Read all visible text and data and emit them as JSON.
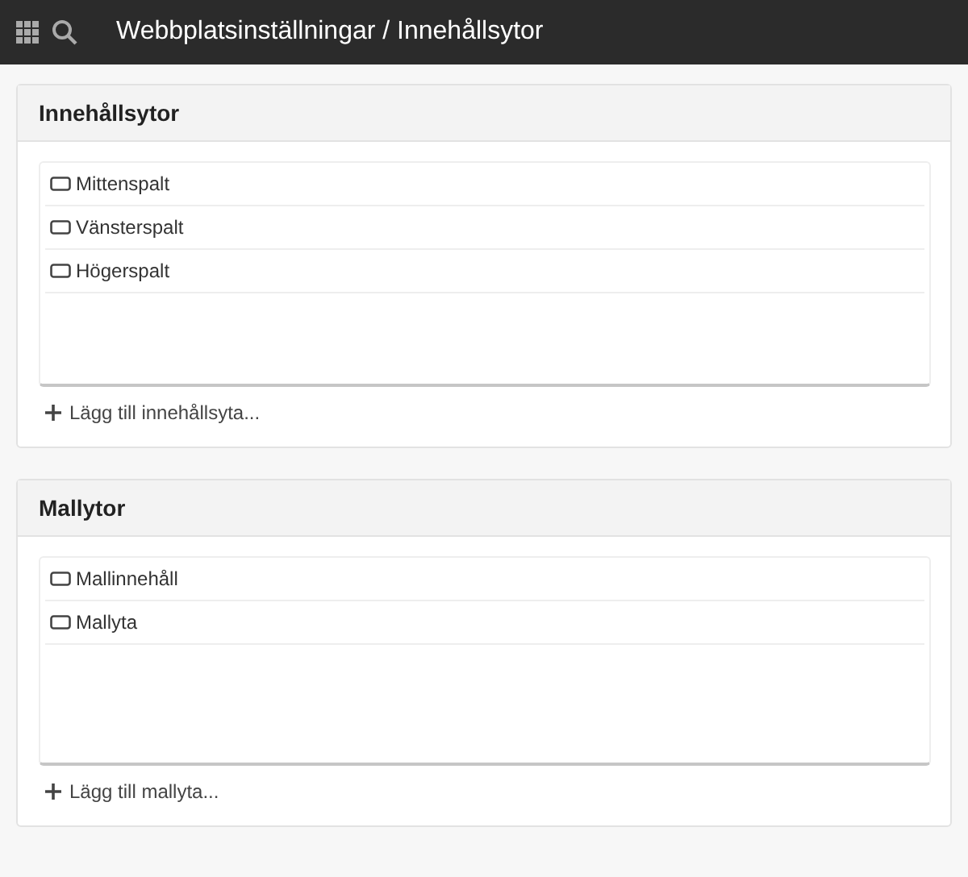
{
  "header": {
    "title": "Webbplatsinställningar / Innehållsytor"
  },
  "panels": [
    {
      "title": "Innehållsytor",
      "items": [
        "Mittenspalt",
        "Vänsterspalt",
        "Högerspalt"
      ],
      "add_label": "Lägg till innehållsyta..."
    },
    {
      "title": "Mallytor",
      "items": [
        "Mallinnehåll",
        "Mallyta"
      ],
      "add_label": "Lägg till mallyta..."
    }
  ]
}
